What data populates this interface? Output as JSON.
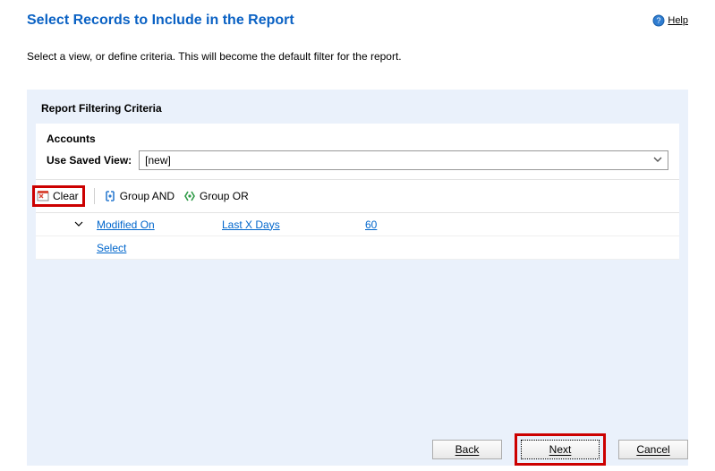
{
  "header": {
    "title": "Select Records to Include in the Report",
    "help_label": "Help"
  },
  "instruction": "Select a view, or define criteria. This will become the default filter for the report.",
  "panel": {
    "title": "Report Filtering Criteria",
    "section": "Accounts",
    "view_label": "Use Saved View:",
    "view_value": "[new]",
    "toolbar": {
      "clear": "Clear",
      "group_and": "Group AND",
      "group_or": "Group OR"
    },
    "criteria": {
      "field": "Modified On",
      "operator": "Last X Days",
      "value": "60",
      "select": "Select"
    }
  },
  "footer": {
    "back": "Back",
    "next": "Next",
    "cancel": "Cancel"
  }
}
